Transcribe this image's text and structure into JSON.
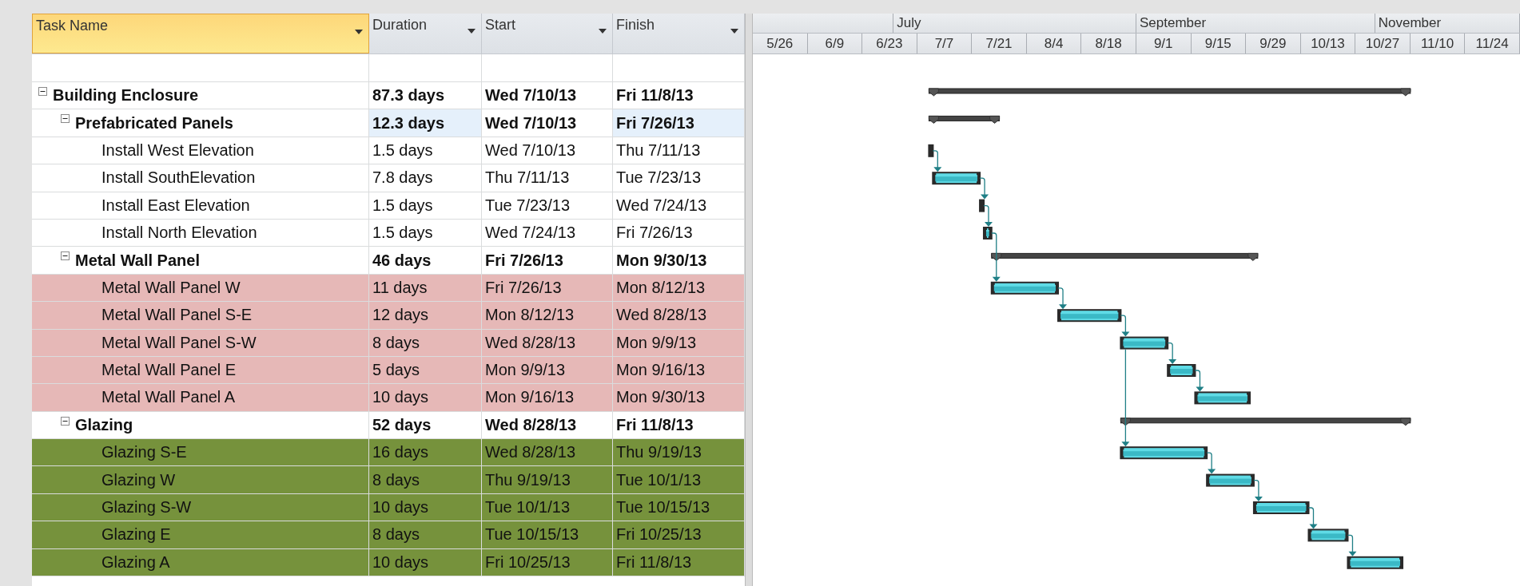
{
  "table": {
    "columns": [
      {
        "label": "Task Name",
        "selected": true
      },
      {
        "label": "Duration",
        "selected": false
      },
      {
        "label": "Start",
        "selected": false
      },
      {
        "label": "Finish",
        "selected": false
      }
    ],
    "rows": [
      {
        "name": "Building Enclosure",
        "duration": "87.3 days",
        "start": "Wed 7/10/13",
        "finish": "Fri 11/8/13",
        "expanded": true,
        "selected": false,
        "children": [
          {
            "name": "Prefabricated Panels",
            "duration": "12.3 days",
            "start": "Wed 7/10/13",
            "finish": "Fri 7/26/13",
            "expanded": true,
            "selected": true,
            "children": [
              {
                "name": "Install West Elevation",
                "duration": "1.5 days",
                "start": "Wed 7/10/13",
                "finish": "Thu 7/11/13",
                "selected": false,
                "linked": false
              },
              {
                "name": "Install SouthElevation",
                "duration": "7.8 days",
                "start": "Thu 7/11/13",
                "finish": "Tue 7/23/13",
                "selected": false,
                "linked": true,
                "start_to_start": false
              },
              {
                "name": "Install East Elevation",
                "duration": "1.5 days",
                "start": "Tue 7/23/13",
                "finish": "Wed 7/24/13",
                "selected": false,
                "linked": true,
                "start_to_start": false
              },
              {
                "name": "Install North Elevation",
                "duration": "1.5 days",
                "start": "Wed 7/24/13",
                "finish": "Fri 7/26/13",
                "selected": false,
                "linked": true,
                "start_to_start": false
              }
            ]
          },
          {
            "name": "Metal Wall Panel",
            "duration": "46 days",
            "start": "Fri 7/26/13",
            "finish": "Mon 9/30/13",
            "expanded": true,
            "selected": false,
            "children": [
              {
                "name": "Metal Wall Panel W",
                "duration": "11 days",
                "start": "Fri 7/26/13",
                "finish": "Mon 8/12/13",
                "selected": false,
                "color": "#e6b8b7",
                "linked": true,
                "start_to_start": false
              },
              {
                "name": "Metal Wall Panel S-E",
                "duration": "12 days",
                "start": "Mon 8/12/13",
                "finish": "Wed 8/28/13",
                "selected": false,
                "color": "#e6b8b7",
                "linked": true,
                "start_to_start": false
              },
              {
                "name": "Metal Wall Panel S-W",
                "duration": "8 days",
                "start": "Wed 8/28/13",
                "finish": "Mon 9/9/13",
                "selected": false,
                "color": "#e6b8b7",
                "linked": true,
                "start_to_start": false
              },
              {
                "name": "Metal Wall Panel E",
                "duration": "5 days",
                "start": "Mon 9/9/13",
                "finish": "Mon 9/16/13",
                "selected": false,
                "color": "#e6b8b7",
                "linked": true,
                "start_to_start": false
              },
              {
                "name": "Metal Wall Panel A",
                "duration": "10 days",
                "start": "Mon 9/16/13",
                "finish": "Mon 9/30/13",
                "selected": false,
                "color": "#e6b8b7",
                "linked": true,
                "start_to_start": false
              }
            ]
          },
          {
            "name": "Glazing",
            "duration": "52 days",
            "start": "Wed 8/28/13",
            "finish": "Fri 11/8/13",
            "expanded": true,
            "selected": false,
            "children": [
              {
                "name": "Glazing S-E",
                "duration": "16 days",
                "start": "Wed 8/28/13",
                "finish": "Thu 9/19/13",
                "selected": false,
                "color": "#76923c",
                "linked": true,
                "start_to_start": true
              },
              {
                "name": "Glazing W",
                "duration": "8 days",
                "start": "Thu 9/19/13",
                "finish": "Tue 10/1/13",
                "selected": false,
                "color": "#76923c",
                "linked": true,
                "start_to_start": false
              },
              {
                "name": "Glazing S-W",
                "duration": "10 days",
                "start": "Tue 10/1/13",
                "finish": "Tue 10/15/13",
                "selected": false,
                "color": "#76923c",
                "linked": true,
                "start_to_start": false
              },
              {
                "name": "Glazing E",
                "duration": "8 days",
                "start": "Tue 10/15/13",
                "finish": "Fri 10/25/13",
                "selected": false,
                "color": "#76923c",
                "linked": true,
                "start_to_start": false
              },
              {
                "name": "Glazing A",
                "duration": "10 days",
                "start": "Fri 10/25/13",
                "finish": "Fri 11/8/13",
                "selected": false,
                "color": "#76923c",
                "linked": true,
                "start_to_start": false
              }
            ]
          }
        ]
      }
    ]
  },
  "timescale": {
    "months": [
      "July",
      "September",
      "November"
    ],
    "weeks": [
      "5/26",
      "6/9",
      "6/23",
      "7/7",
      "7/21",
      "8/4",
      "8/18",
      "9/1",
      "9/15",
      "9/29",
      "10/13",
      "10/27",
      "11/10",
      "11/24"
    ]
  }
}
